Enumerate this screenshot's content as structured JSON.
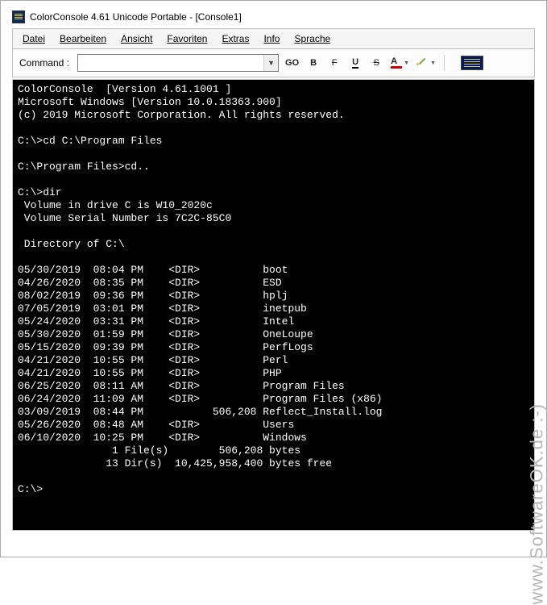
{
  "title": "ColorConsole 4.61 Unicode Portable - [Console1]",
  "menus": {
    "datei": "Datei",
    "bearbeiten": "Bearbeiten",
    "ansicht": "Ansicht",
    "favoriten": "Favoriten",
    "extras": "Extras",
    "info": "Info",
    "sprache": "Sprache"
  },
  "toolbar": {
    "command_label": "Command :",
    "command_value": "",
    "go": "GO",
    "bold": "B",
    "strike": "F",
    "underline": "U",
    "strike2": "S",
    "fontcolor": "A"
  },
  "watermark": "www.SoftwareOK.de :-)",
  "console": {
    "header": [
      "ColorConsole  [Version 4.61.1001 ]",
      "Microsoft Windows [Version 10.0.18363.900]",
      "(c) 2019 Microsoft Corporation. All rights reserved.",
      ""
    ],
    "cmds": [
      "C:\\>cd C:\\Program Files",
      "",
      "C:\\Program Files>cd..",
      "",
      "C:\\>dir"
    ],
    "vol1": " Volume in drive C is W10_2020c",
    "vol2": " Volume Serial Number is 7C2C-85C0",
    "dirof": " Directory of C:\\",
    "entries": [
      {
        "d": "05/30/2019",
        "t": "08:04 PM",
        "s": "<DIR>         ",
        "n": "boot"
      },
      {
        "d": "04/26/2020",
        "t": "08:35 PM",
        "s": "<DIR>         ",
        "n": "ESD"
      },
      {
        "d": "08/02/2019",
        "t": "09:36 PM",
        "s": "<DIR>         ",
        "n": "hplj"
      },
      {
        "d": "07/05/2019",
        "t": "03:01 PM",
        "s": "<DIR>         ",
        "n": "inetpub"
      },
      {
        "d": "05/24/2020",
        "t": "03:31 PM",
        "s": "<DIR>         ",
        "n": "Intel"
      },
      {
        "d": "05/30/2020",
        "t": "01:59 PM",
        "s": "<DIR>         ",
        "n": "OneLoupe"
      },
      {
        "d": "05/15/2020",
        "t": "09:39 PM",
        "s": "<DIR>         ",
        "n": "PerfLogs"
      },
      {
        "d": "04/21/2020",
        "t": "10:55 PM",
        "s": "<DIR>         ",
        "n": "Perl"
      },
      {
        "d": "04/21/2020",
        "t": "10:55 PM",
        "s": "<DIR>         ",
        "n": "PHP"
      },
      {
        "d": "06/25/2020",
        "t": "08:11 AM",
        "s": "<DIR>         ",
        "n": "Program Files"
      },
      {
        "d": "06/24/2020",
        "t": "11:09 AM",
        "s": "<DIR>         ",
        "n": "Program Files (x86)"
      },
      {
        "d": "03/09/2019",
        "t": "08:44 PM",
        "s": "       506,208",
        "n": "Reflect_Install.log"
      },
      {
        "d": "05/26/2020",
        "t": "08:48 AM",
        "s": "<DIR>         ",
        "n": "Users"
      },
      {
        "d": "06/10/2020",
        "t": "10:25 PM",
        "s": "<DIR>         ",
        "n": "Windows"
      }
    ],
    "sum1": "               1 File(s)        506,208 bytes",
    "sum2": "              13 Dir(s)  10,425,958,400 bytes free",
    "prompt": "C:\\>"
  }
}
